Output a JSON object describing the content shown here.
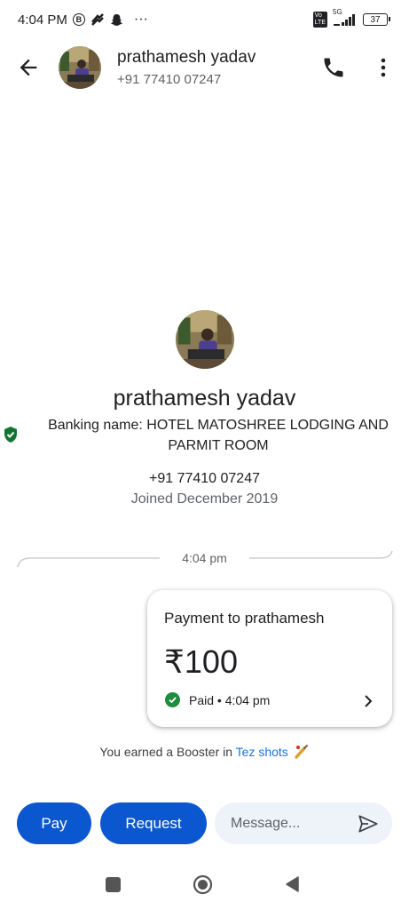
{
  "status_bar": {
    "time": "4:04 PM",
    "more": "···",
    "network": "5G",
    "battery": "37"
  },
  "header": {
    "name": "prathamesh yadav",
    "phone": "+91 77410 07247"
  },
  "profile": {
    "name": "prathamesh yadav",
    "banking_name": "Banking name: HOTEL MATOSHREE LODGING AND PARMIT ROOM",
    "phone": "+91 77410 07247",
    "joined": "Joined December 2019"
  },
  "chat": {
    "divider_time": "4:04 pm",
    "payment": {
      "title": "Payment to prathamesh",
      "amount": "₹100",
      "status": "Paid • 4:04 pm"
    },
    "booster_prefix": "You earned a Booster in ",
    "booster_link": "Tez shots"
  },
  "actions": {
    "pay_label": "Pay",
    "request_label": "Request",
    "message_placeholder": "Message..."
  },
  "colors": {
    "primary": "#0b57d0",
    "success": "#1e8e3e",
    "link": "#1a73e8"
  },
  "icons": [
    "back-arrow-icon",
    "phone-icon",
    "more-vert-icon",
    "verified-shield-icon",
    "check-circle-icon",
    "chevron-right-icon",
    "send-icon",
    "cricket-bat-icon"
  ]
}
